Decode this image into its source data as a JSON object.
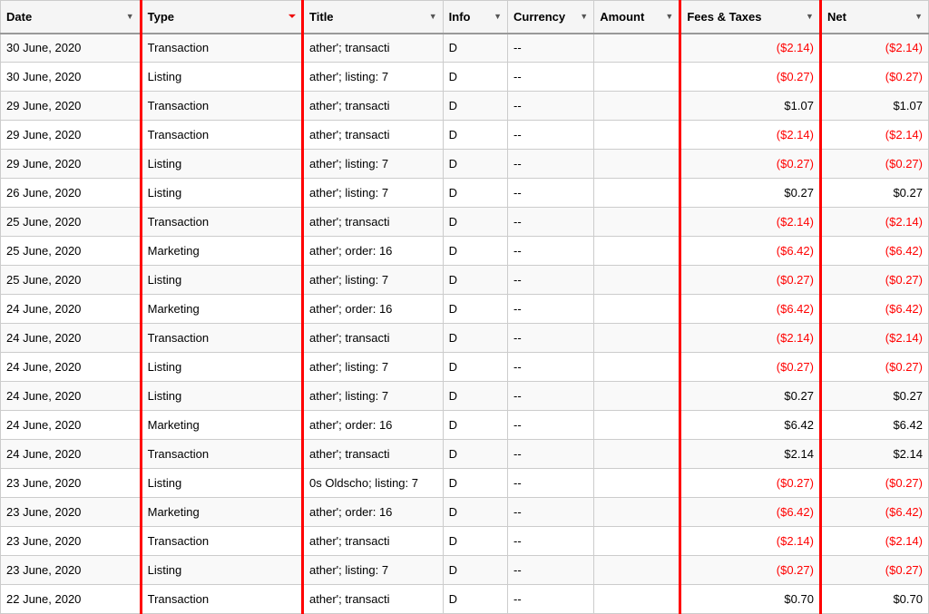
{
  "columns": [
    {
      "id": "date",
      "label": "Date",
      "class": "col-date",
      "sortable": false,
      "filterable": true
    },
    {
      "id": "type",
      "label": "Type",
      "class": "col-type",
      "sortable": true,
      "filterable": false
    },
    {
      "id": "title",
      "label": "Title",
      "class": "col-title",
      "sortable": false,
      "filterable": true
    },
    {
      "id": "info",
      "label": "Info",
      "class": "col-info",
      "sortable": false,
      "filterable": true
    },
    {
      "id": "currency",
      "label": "Currency",
      "class": "col-currency",
      "sortable": false,
      "filterable": true
    },
    {
      "id": "amount",
      "label": "Amount",
      "class": "col-amount",
      "sortable": false,
      "filterable": true
    },
    {
      "id": "fees",
      "label": "Fees & Taxes",
      "class": "col-fees",
      "sortable": false,
      "filterable": true
    },
    {
      "id": "net",
      "label": "Net",
      "class": "col-net",
      "sortable": false,
      "filterable": true
    }
  ],
  "rows": [
    {
      "date": "30 June, 2020",
      "type": "Transaction",
      "title": "ather&#39;",
      "info_short": "transacti",
      "info": "D",
      "currency": "--",
      "amount": "",
      "fees": "($2.14)",
      "fees_red": true,
      "net": "($2.14)",
      "net_red": true
    },
    {
      "date": "30 June, 2020",
      "type": "Listing",
      "title": "ather&#39;",
      "info_short": "listing: 7",
      "info": "D",
      "currency": "--",
      "amount": "",
      "fees": "($0.27)",
      "fees_red": true,
      "net": "($0.27)",
      "net_red": true
    },
    {
      "date": "29 June, 2020",
      "type": "Transaction",
      "title": "ather&#39;",
      "info_short": "transacti",
      "info": "D",
      "currency": "--",
      "amount": "",
      "fees": "$1.07",
      "fees_red": false,
      "net": "$1.07",
      "net_red": false
    },
    {
      "date": "29 June, 2020",
      "type": "Transaction",
      "title": "ather&#39;",
      "info_short": "transacti",
      "info": "D",
      "currency": "--",
      "amount": "",
      "fees": "($2.14)",
      "fees_red": true,
      "net": "($2.14)",
      "net_red": true
    },
    {
      "date": "29 June, 2020",
      "type": "Listing",
      "title": "ather&#39;",
      "info_short": "listing: 7",
      "info": "D",
      "currency": "--",
      "amount": "",
      "fees": "($0.27)",
      "fees_red": true,
      "net": "($0.27)",
      "net_red": true
    },
    {
      "date": "26 June, 2020",
      "type": "Listing",
      "title": "ather&#39;",
      "info_short": "listing: 7",
      "info": "D",
      "currency": "--",
      "amount": "",
      "fees": "$0.27",
      "fees_red": false,
      "net": "$0.27",
      "net_red": false
    },
    {
      "date": "25 June, 2020",
      "type": "Transaction",
      "title": "ather&#39;",
      "info_short": "transacti",
      "info": "D",
      "currency": "--",
      "amount": "",
      "fees": "($2.14)",
      "fees_red": true,
      "net": "($2.14)",
      "net_red": true
    },
    {
      "date": "25 June, 2020",
      "type": "Marketing",
      "title": "ather&#39;",
      "info_short": "order: 16",
      "info": "D",
      "currency": "--",
      "amount": "",
      "fees": "($6.42)",
      "fees_red": true,
      "net": "($6.42)",
      "net_red": true
    },
    {
      "date": "25 June, 2020",
      "type": "Listing",
      "title": "ather&#39;",
      "info_short": "listing: 7",
      "info": "D",
      "currency": "--",
      "amount": "",
      "fees": "($0.27)",
      "fees_red": true,
      "net": "($0.27)",
      "net_red": true
    },
    {
      "date": "24 June, 2020",
      "type": "Marketing",
      "title": "ather&#39;",
      "info_short": "order: 16",
      "info": "D",
      "currency": "--",
      "amount": "",
      "fees": "($6.42)",
      "fees_red": true,
      "net": "($6.42)",
      "net_red": true
    },
    {
      "date": "24 June, 2020",
      "type": "Transaction",
      "title": "ather&#39;",
      "info_short": "transacti",
      "info": "D",
      "currency": "--",
      "amount": "",
      "fees": "($2.14)",
      "fees_red": true,
      "net": "($2.14)",
      "net_red": true
    },
    {
      "date": "24 June, 2020",
      "type": "Listing",
      "title": "ather&#39;",
      "info_short": "listing: 7",
      "info": "D",
      "currency": "--",
      "amount": "",
      "fees": "($0.27)",
      "fees_red": true,
      "net": "($0.27)",
      "net_red": true
    },
    {
      "date": "24 June, 2020",
      "type": "Listing",
      "title": "ather&#39;",
      "info_short": "listing: 7",
      "info": "D",
      "currency": "--",
      "amount": "",
      "fees": "$0.27",
      "fees_red": false,
      "net": "$0.27",
      "net_red": false
    },
    {
      "date": "24 June, 2020",
      "type": "Marketing",
      "title": "ather&#39;",
      "info_short": "order: 16",
      "info": "D",
      "currency": "--",
      "amount": "",
      "fees": "$6.42",
      "fees_red": false,
      "net": "$6.42",
      "net_red": false
    },
    {
      "date": "24 June, 2020",
      "type": "Transaction",
      "title": "ather&#39;",
      "info_short": "transacti",
      "info": "D",
      "currency": "--",
      "amount": "",
      "fees": "$2.14",
      "fees_red": false,
      "net": "$2.14",
      "net_red": false
    },
    {
      "date": "23 June, 2020",
      "type": "Listing",
      "title": "0s Oldscho",
      "info_short": "listing: 7",
      "info": "D",
      "currency": "--",
      "amount": "",
      "fees": "($0.27)",
      "fees_red": true,
      "net": "($0.27)",
      "net_red": true
    },
    {
      "date": "23 June, 2020",
      "type": "Marketing",
      "title": "ather&#39;",
      "info_short": "order: 16",
      "info": "D",
      "currency": "--",
      "amount": "",
      "fees": "($6.42)",
      "fees_red": true,
      "net": "($6.42)",
      "net_red": true
    },
    {
      "date": "23 June, 2020",
      "type": "Transaction",
      "title": "ather&#39;",
      "info_short": "transacti",
      "info": "D",
      "currency": "--",
      "amount": "",
      "fees": "($2.14)",
      "fees_red": true,
      "net": "($2.14)",
      "net_red": true
    },
    {
      "date": "23 June, 2020",
      "type": "Listing",
      "title": "ather&#39;",
      "info_short": "listing: 7",
      "info": "D",
      "currency": "--",
      "amount": "",
      "fees": "($0.27)",
      "fees_red": true,
      "net": "($0.27)",
      "net_red": true
    },
    {
      "date": "22 June, 2020",
      "type": "Transaction",
      "title": "ather&#39;",
      "info_short": "transacti",
      "info": "D",
      "currency": "--",
      "amount": "",
      "fees": "$0.70",
      "fees_red": false,
      "net": "$0.70",
      "net_red": false
    }
  ]
}
